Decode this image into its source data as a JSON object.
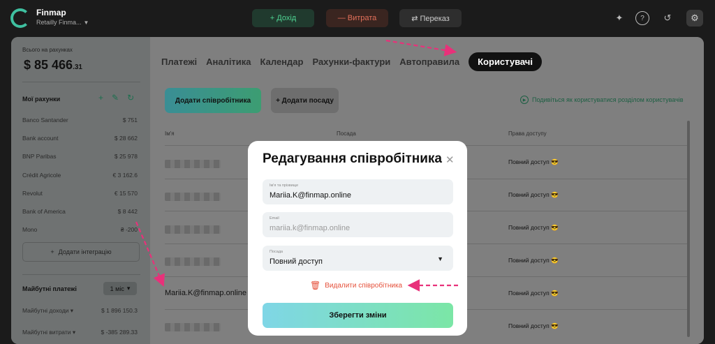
{
  "topbar": {
    "brand": "Finmap",
    "company": "Retailly Finma...",
    "income_label": "+ Дохід",
    "expense_label": "— Витрата",
    "transfer_label": "⇄ Переказ",
    "icons": [
      "sparkle-icon",
      "help-icon",
      "history-icon",
      "gear-icon"
    ]
  },
  "sidebar": {
    "total_label": "Всього на рахунках",
    "total_main": "$ 85 466",
    "total_cents": ".31",
    "accounts_title": "Мої рахунки",
    "accounts": [
      {
        "name": "Banco Santander",
        "amount": "$ 751"
      },
      {
        "name": "Bank account",
        "amount": "$ 28 662"
      },
      {
        "name": "BNP Paribas",
        "amount": "$ 25 978"
      },
      {
        "name": "Crédit Agricole",
        "amount": "€ 3 162.6"
      },
      {
        "name": "Revolut",
        "amount": "€ 15 570"
      },
      {
        "name": "Bank of America",
        "amount": "$ 8 442"
      },
      {
        "name": "Mono",
        "amount": "₴ -200"
      }
    ],
    "add_integration": "Додати інтеграцію",
    "future_title": "Майбутні платежі",
    "period": "1 міс",
    "future": [
      {
        "name": "Майбутні доходи",
        "amount": "$ 1 896 150.3"
      },
      {
        "name": "Майбутні витрати",
        "amount": "$ -385 289.33"
      }
    ]
  },
  "main": {
    "tabs": [
      {
        "label": "Платежі",
        "active": false
      },
      {
        "label": "Аналітика",
        "active": false
      },
      {
        "label": "Календар",
        "active": false
      },
      {
        "label": "Рахунки-фактури",
        "active": false
      },
      {
        "label": "Автоправила",
        "active": false
      },
      {
        "label": "Користувачі",
        "active": true
      }
    ],
    "add_employee": "Додати співробітника",
    "add_position": "+ Додати посаду",
    "howto": "Подивіться як користуватися розділом користувачів",
    "columns": [
      "Ім'я",
      "Посада",
      "Права доступу"
    ],
    "row_email": "Mariia.K@finmap.online",
    "access_value": "Повний доступ 😎"
  },
  "modal": {
    "title": "Редагування співробітника",
    "name_label": "Ім'я та прізвище",
    "name_value": "Mariia.K@finmap.online",
    "email_label": "Email",
    "email_value": "mariia.k@finmap.online",
    "position_label": "Посада",
    "position_value": "Повний доступ",
    "delete_label": "Видалити співробітника",
    "save_label": "Зберегти зміни"
  },
  "colors": {
    "accent_green": "#4fd493",
    "accent_red": "#e3705a",
    "annotation_pink": "#e8317a"
  }
}
